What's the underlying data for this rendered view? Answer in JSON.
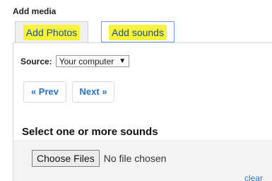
{
  "section_title": "Add media",
  "tabs": [
    {
      "label": "Add Photos"
    },
    {
      "label": "Add sounds"
    }
  ],
  "source": {
    "label": "Source:",
    "selected": "Your computer"
  },
  "pager": {
    "prev_label": "« Prev",
    "next_label": "Next »"
  },
  "heading": "Select one or more sounds",
  "file_input": {
    "button_label": "Choose Files",
    "status": "No file chosen"
  },
  "clear_label": "clear",
  "colors": {
    "highlight": "#f7f23a",
    "link": "#2a70c9",
    "active_tab_border": "#6e9de6"
  }
}
